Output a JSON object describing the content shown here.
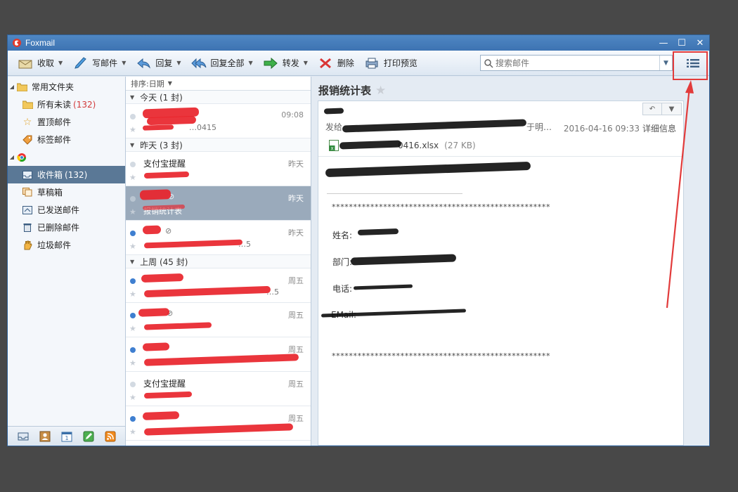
{
  "window": {
    "title": "Foxmail",
    "controls": [
      "—",
      "☐",
      "✕"
    ]
  },
  "toolbar": {
    "receive": "收取",
    "compose": "写邮件",
    "reply": "回复",
    "reply_all": "回复全部",
    "forward": "转发",
    "delete": "删除",
    "print_preview": "打印预览",
    "search_placeholder": "搜索邮件"
  },
  "sidebar": {
    "common_folder": "常用文件夹",
    "all_unread": "所有未读",
    "all_unread_count": "(132)",
    "pinned": "置顶邮件",
    "tagged": "标签邮件",
    "inbox": "收件箱",
    "inbox_count": "(132)",
    "drafts": "草稿箱",
    "sent": "已发送邮件",
    "deleted": "已删除邮件",
    "junk": "垃圾邮件"
  },
  "list": {
    "sort": "排序:日期",
    "groups": {
      "today": "今天 (1 封)",
      "yesterday": "昨天 (3 封)",
      "last_week": "上周 (45 封)"
    },
    "mails": [
      {
        "sender": "",
        "subject": "…0415",
        "time": "09:08"
      },
      {
        "sender": "支付宝提醒",
        "subject": "",
        "time": "昨天"
      },
      {
        "sender": "",
        "subject": "报销统计表",
        "time": "昨天"
      },
      {
        "sender": "",
        "subject": "…5",
        "time": "昨天"
      },
      {
        "sender": "",
        "subject": "…5",
        "time": "周五"
      },
      {
        "sender": "",
        "subject": "",
        "time": "周五"
      },
      {
        "sender": "",
        "subject": "",
        "time": "周五"
      },
      {
        "sender": "支付宝提醒",
        "subject": "",
        "time": "周五"
      },
      {
        "sender": "",
        "subject": "",
        "time": "周五"
      }
    ]
  },
  "reader": {
    "title": "报销统计表",
    "from_label": "发给",
    "meta_tail": "于明…",
    "date": "2016-04-16 09:33",
    "detail": "详细信息",
    "attachment_name": "0416.xlsx",
    "attachment_size": "(27 KB)",
    "stars_line": "***************************************************",
    "name_label": "姓名:",
    "dept_label": "部门:",
    "phone_label": "电话:",
    "email_label": "EMail:"
  }
}
